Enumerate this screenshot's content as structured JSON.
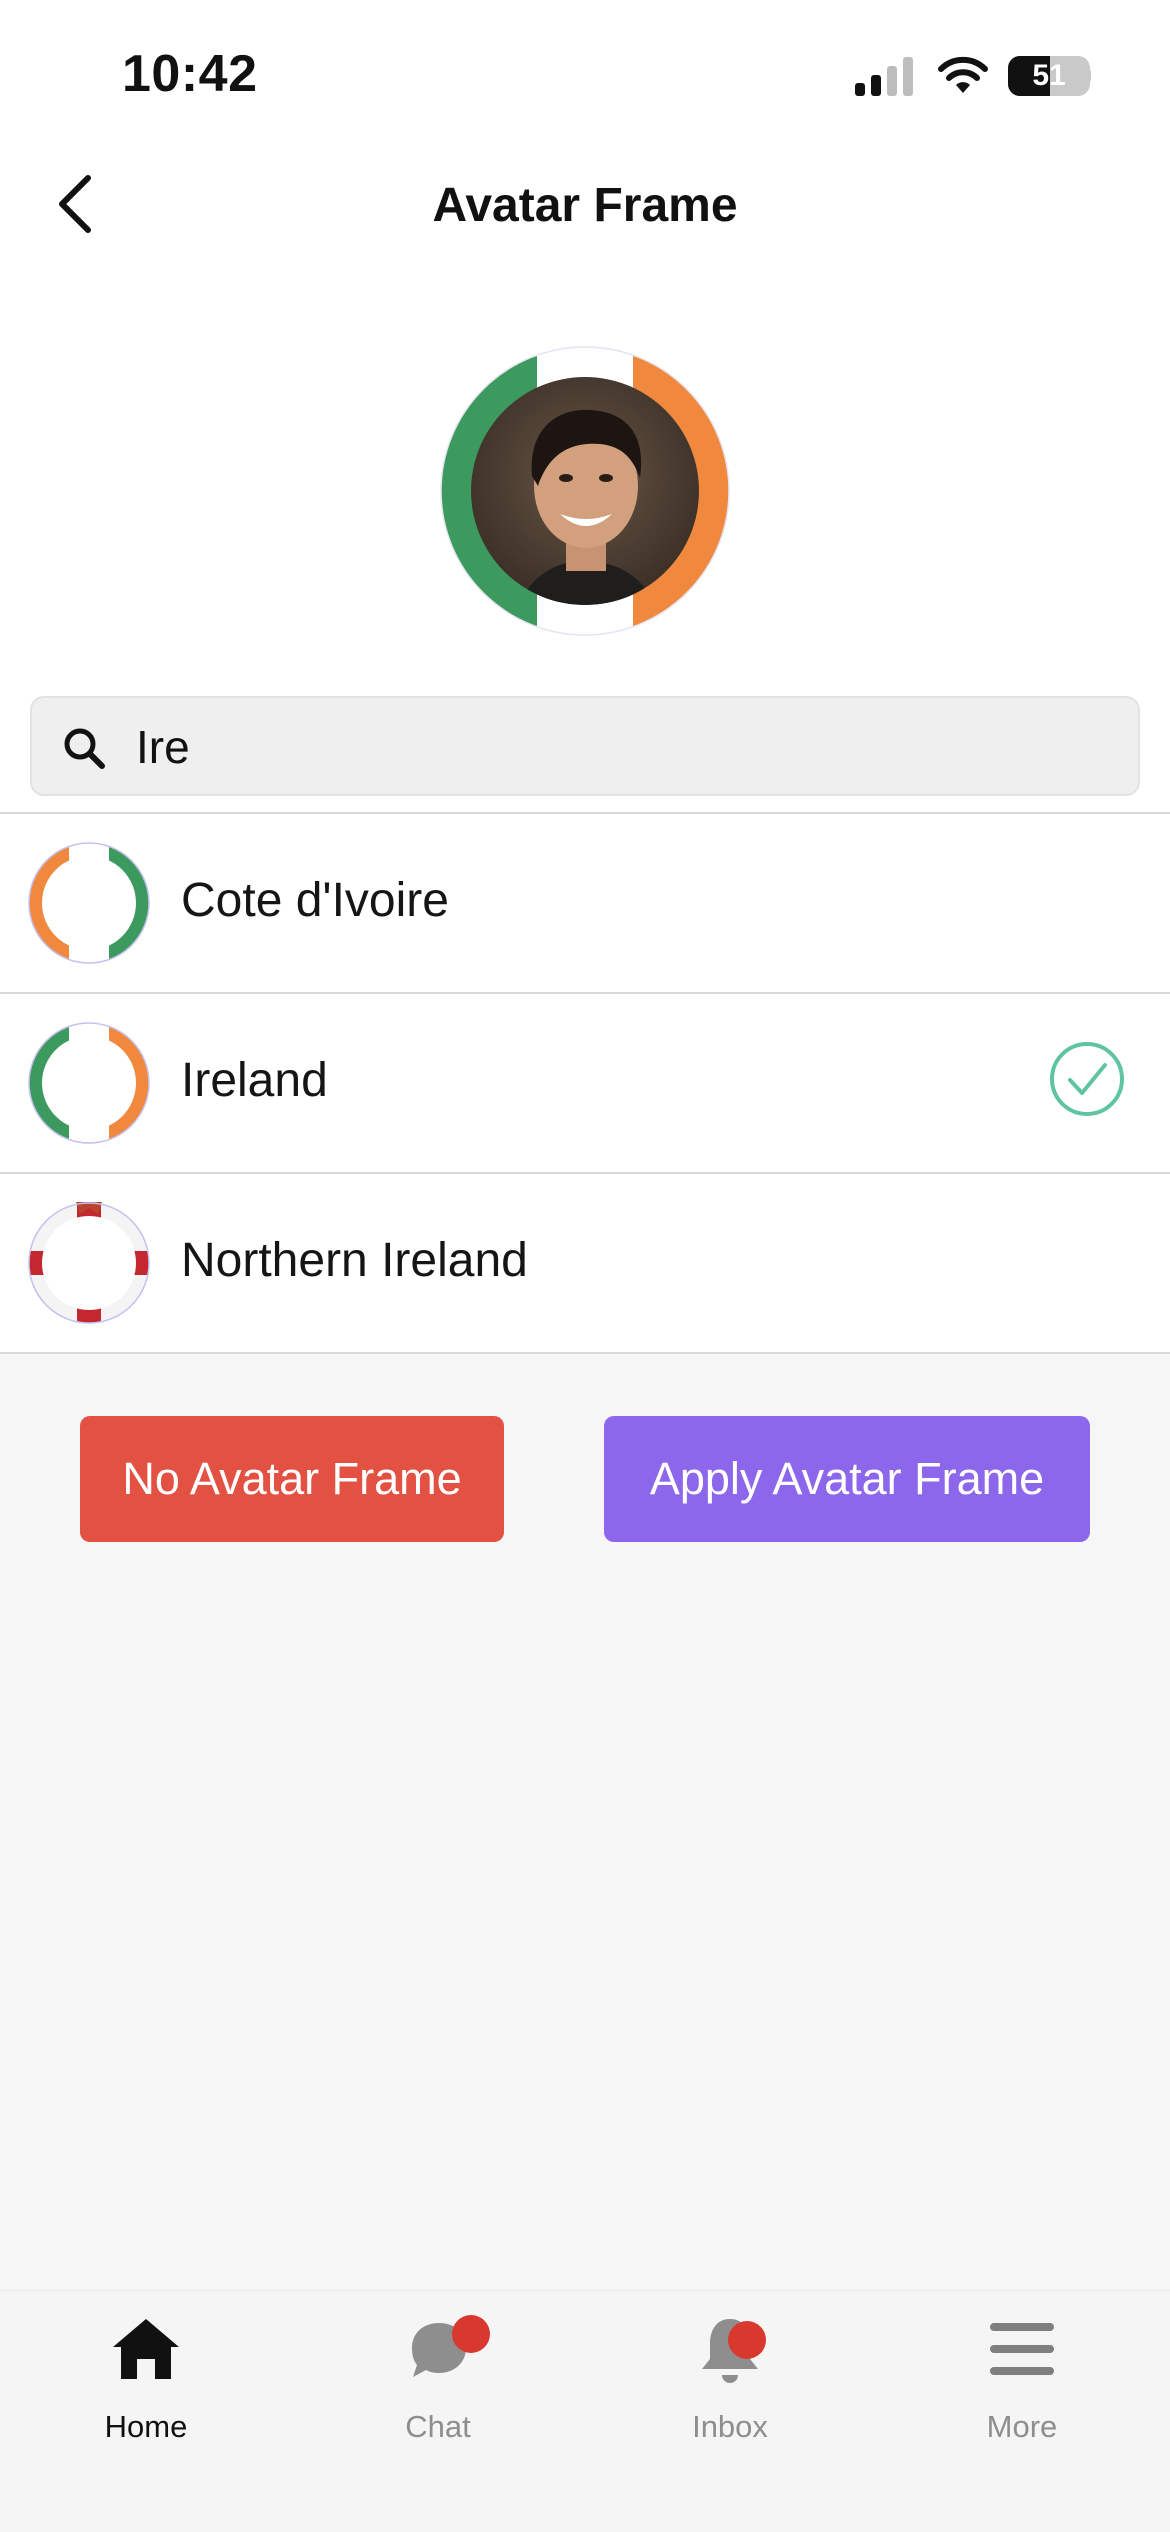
{
  "status_bar": {
    "time": "10:42",
    "battery": "51",
    "battery_level_percent": 51
  },
  "header": {
    "title": "Avatar Frame",
    "back_icon": "chevron-left-icon"
  },
  "search": {
    "value": "Ire",
    "icon": "search-icon"
  },
  "results": [
    {
      "label": "Cote d'Ivoire",
      "selected": false,
      "flag_colors": [
        "#f0883e",
        "#ffffff",
        "#3d9a5f"
      ]
    },
    {
      "label": "Ireland",
      "selected": true,
      "flag_colors": [
        "#3d9a5f",
        "#ffffff",
        "#f0883e"
      ]
    },
    {
      "label": "Northern Ireland",
      "selected": false,
      "flag_colors": [
        "#ffffff",
        "#c4272f"
      ]
    }
  ],
  "actions": {
    "no_frame_label": "No Avatar Frame",
    "apply_label": "Apply Avatar Frame"
  },
  "tabbar": {
    "tabs": [
      {
        "label": "Home",
        "icon": "home-icon",
        "active": true,
        "badge": false
      },
      {
        "label": "Chat",
        "icon": "chat-icon",
        "active": false,
        "badge": true
      },
      {
        "label": "Inbox",
        "icon": "bell-icon",
        "active": false,
        "badge": true
      },
      {
        "label": "More",
        "icon": "menu-icon",
        "active": false,
        "badge": false
      }
    ]
  },
  "colors": {
    "accent_purple": "#8d67eb",
    "danger_red": "#e35143",
    "check_green": "#5ec5a0",
    "badge_red": "#d9382f"
  }
}
